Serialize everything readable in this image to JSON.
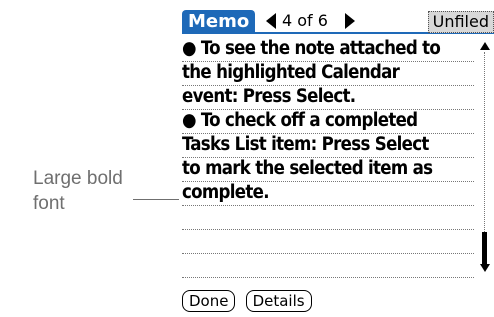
{
  "callout": {
    "line1": "Large bold",
    "line2": "font"
  },
  "titlebar": {
    "app_name": "Memo",
    "page_indicator": "4 of 6",
    "category": "Unfiled",
    "prev_icon": "left-triangle-icon",
    "next_icon": "right-triangle-icon"
  },
  "note": {
    "lines": [
      "● To see the note attached to",
      "the highlighted Calendar",
      "event: Press Select.",
      "● To check off a completed",
      "Tasks List item: Press Select",
      "to mark the selected item as",
      "complete.",
      "",
      "",
      ""
    ]
  },
  "scrollbar": {
    "up_icon": "scroll-up-arrow-icon",
    "down_icon": "scroll-down-arrow-icon",
    "position": 1.0
  },
  "buttons": {
    "done": "Done",
    "details": "Details"
  },
  "colors": {
    "title_blue": "#1e69b8",
    "callout_gray": "#6f6f6f",
    "category_bg": "#d8d8d8"
  }
}
